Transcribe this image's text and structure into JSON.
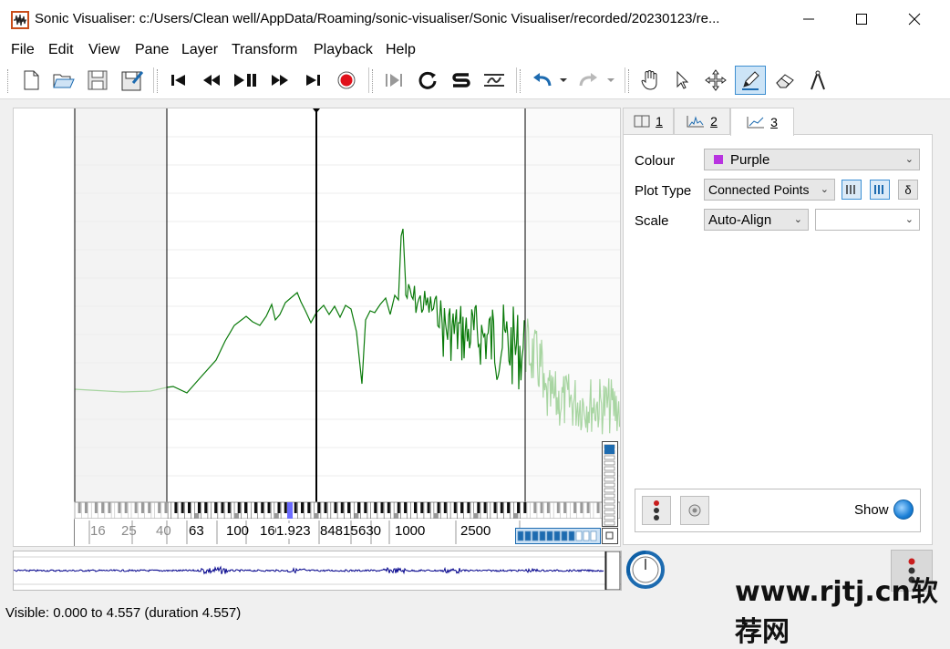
{
  "window": {
    "title": "Sonic Visualiser: c:/Users/Clean well/AppData/Roaming/sonic-visualiser/Sonic Visualiser/recorded/20230123/re...",
    "minimize_icon": "minimize-icon",
    "maximize_icon": "maximize-icon",
    "close_icon": "close-icon"
  },
  "menu": [
    {
      "label": "File"
    },
    {
      "label": "Edit"
    },
    {
      "label": "View"
    },
    {
      "label": "Pane"
    },
    {
      "label": "Layer"
    },
    {
      "label": "Transform"
    },
    {
      "label": "Playback"
    },
    {
      "label": "Help"
    }
  ],
  "toolbar": {
    "file": [
      "new-file-icon",
      "open-folder-icon",
      "save-icon",
      "save-session-icon"
    ],
    "transport": [
      "rewind-start-icon",
      "rewind-icon",
      "play-pause-icon",
      "fast-forward-icon",
      "forward-end-icon",
      "record-icon"
    ],
    "playmode": [
      "play-selection-icon",
      "loop-icon",
      "solo-icon",
      "follow-playback-icon"
    ],
    "undo": [
      "undo-icon",
      "redo-icon"
    ],
    "tools": [
      "navigate-icon",
      "select-icon",
      "move-icon",
      "draw-icon",
      "erase-icon",
      "measure-icon"
    ]
  },
  "pane": {
    "playhead_time": "1.923",
    "freq_labels": [
      "16",
      "25",
      "40",
      "63",
      "100",
      "160",
      "848",
      "15",
      "630",
      "1000",
      "2500"
    ],
    "line_color": "#0a7a0a",
    "faded_line_color": "#a8d5a2"
  },
  "layer_tabs": [
    {
      "label": "1",
      "icon": "pane-icon"
    },
    {
      "label": "2",
      "icon": "spectrum-icon"
    },
    {
      "label": "3",
      "icon": "line-graph-icon"
    }
  ],
  "properties": {
    "colour_label": "Colour",
    "colour_value": "Purple",
    "colour_swatch": "#b833e0",
    "plot_type_label": "Plot Type",
    "plot_type_value": "Connected Points",
    "scale_label": "Scale",
    "scale_value": "Auto-Align",
    "scale_extra_value": "",
    "delta_button": "δ",
    "show_label": "Show"
  },
  "status": {
    "visible": "Visible: 0.000 to 4.557 (duration 4.557)"
  },
  "watermark": "www.rjtj.cn软荐网"
}
